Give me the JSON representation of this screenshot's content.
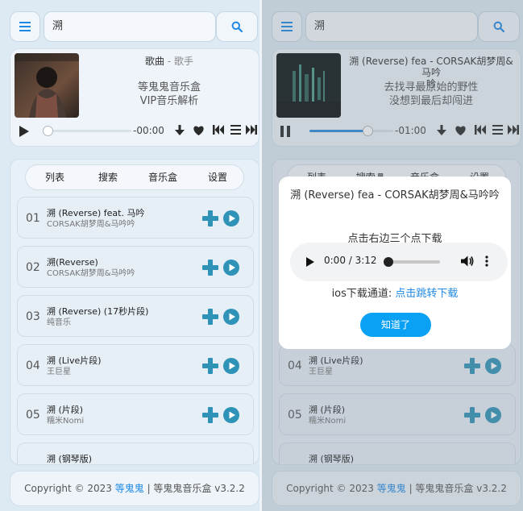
{
  "search": {
    "query": "溯"
  },
  "colors": {
    "accent": "#1e88e5",
    "icon_teal": "#2f93b8",
    "ok_button": "#0aa1f5"
  },
  "left": {
    "player": {
      "title": "歌曲",
      "sep": " - ",
      "artist": "歌手",
      "lyric1": "等鬼鬼音乐盒",
      "lyric2": "VIP音乐解析",
      "time": "-00:00",
      "progress": 0.0
    }
  },
  "right": {
    "player": {
      "title_line1": "溯 (Reverse) fea - CORSAK胡梦周&马吟",
      "title_line2": "吟",
      "lyric1": "去找寻最原始的野性",
      "lyric2": "没想到最后却闯进",
      "time": "-01:00",
      "progress": 0.7
    },
    "list_partial": [
      {
        "num": "04",
        "name": "溯 (Live片段)",
        "singer": "王巨星"
      },
      {
        "num": "05",
        "name": "溯 (片段)",
        "singer": "糯米Nomi"
      },
      {
        "name": "溯 (钢琴版)"
      }
    ],
    "tabs": [
      "列表",
      "搜索♬",
      "音乐盒",
      "设置"
    ]
  },
  "tabs": [
    "列表",
    "搜索",
    "音乐盒",
    "设置"
  ],
  "songs": [
    {
      "num": "01",
      "name": "溯 (Reverse) feat. 马吟",
      "singer": "CORSAK胡梦周&马吟吟"
    },
    {
      "num": "02",
      "name": "溯(Reverse)",
      "singer": "CORSAK胡梦周&马吟吟"
    },
    {
      "num": "03",
      "name": "溯 (Reverse) (17秒片段)",
      "singer": "纯音乐"
    },
    {
      "num": "04",
      "name": "溯 (Live片段)",
      "singer": "王巨星"
    },
    {
      "num": "05",
      "name": "溯 (片段)",
      "singer": "糯米Nomi"
    },
    {
      "num": "",
      "name": "溯 (钢琴版)",
      "singer": ""
    }
  ],
  "footer": {
    "prefix": "Copyright © 2023 ",
    "author": "等鬼鬼",
    "suffix": " | 等鬼鬼音乐盒 v3.2.2"
  },
  "dialog": {
    "title": "溯 (Reverse) fea - CORSAK胡梦周&马吟吟",
    "hint": "点击右边三个点下载",
    "audio_time": "0:00 / 3:12",
    "audio_progress": 0.0,
    "ios_label": "ios下载通道: ",
    "ios_link": "点击跳转下载",
    "ok_label": "知道了"
  }
}
